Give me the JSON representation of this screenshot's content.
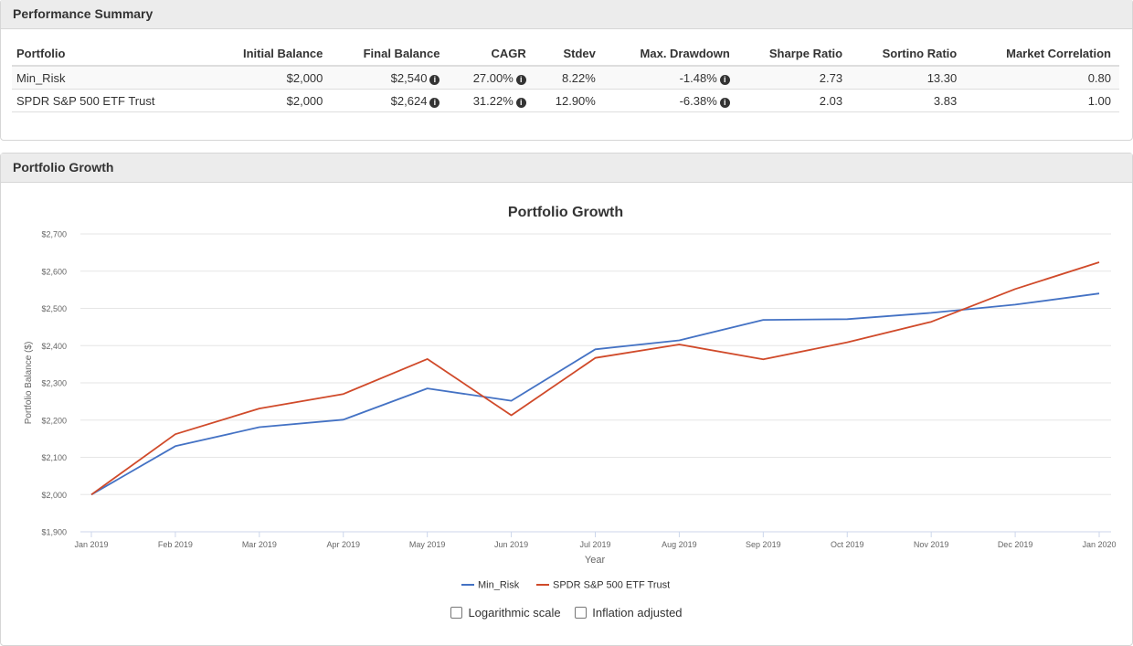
{
  "summary": {
    "title": "Performance Summary",
    "columns": [
      "Portfolio",
      "Initial Balance",
      "Final Balance",
      "CAGR",
      "Stdev",
      "Max. Drawdown",
      "Sharpe Ratio",
      "Sortino Ratio",
      "Market Correlation"
    ],
    "rows": [
      {
        "portfolio": "Min_Risk",
        "initial": "$2,000",
        "final": "$2,540",
        "cagr": "27.00%",
        "stdev": "8.22%",
        "drawdown": "-1.48%",
        "sharpe": "2.73",
        "sortino": "13.30",
        "corr": "0.80"
      },
      {
        "portfolio": "SPDR S&P 500 ETF Trust",
        "initial": "$2,000",
        "final": "$2,624",
        "cagr": "31.22%",
        "stdev": "12.90%",
        "drawdown": "-6.38%",
        "sharpe": "2.03",
        "sortino": "3.83",
        "corr": "1.00"
      }
    ]
  },
  "growth": {
    "title": "Portfolio Growth",
    "log_label": "Logarithmic scale",
    "log_checked": false,
    "inflation_label": "Inflation adjusted",
    "inflation_checked": false
  },
  "chart_data": {
    "type": "line",
    "title": "Portfolio Growth",
    "xlabel": "Year",
    "ylabel": "Portfolio Balance ($)",
    "ylim": [
      1900,
      2700
    ],
    "yticks": [
      1900,
      2000,
      2100,
      2200,
      2300,
      2400,
      2500,
      2600,
      2700
    ],
    "ytick_labels": [
      "$1,900",
      "$2,000",
      "$2,100",
      "$2,200",
      "$2,300",
      "$2,400",
      "$2,500",
      "$2,600",
      "$2,700"
    ],
    "categories": [
      "Jan 2019",
      "Feb 2019",
      "Mar 2019",
      "Apr 2019",
      "May 2019",
      "Jun 2019",
      "Jul 2019",
      "Aug 2019",
      "Sep 2019",
      "Oct 2019",
      "Nov 2019",
      "Dec 2019",
      "Jan 2020"
    ],
    "legend_position": "bottom",
    "grid": true,
    "series": [
      {
        "name": "Min_Risk",
        "color": "#4472c4",
        "values": [
          2000,
          2130,
          2181,
          2201,
          2285,
          2252,
          2390,
          2414,
          2469,
          2471,
          2488,
          2510,
          2540
        ]
      },
      {
        "name": "SPDR S&P 500 ETF Trust",
        "color": "#d04a2a",
        "values": [
          2000,
          2162,
          2231,
          2270,
          2364,
          2213,
          2367,
          2403,
          2363,
          2409,
          2464,
          2552,
          2624
        ]
      }
    ]
  }
}
